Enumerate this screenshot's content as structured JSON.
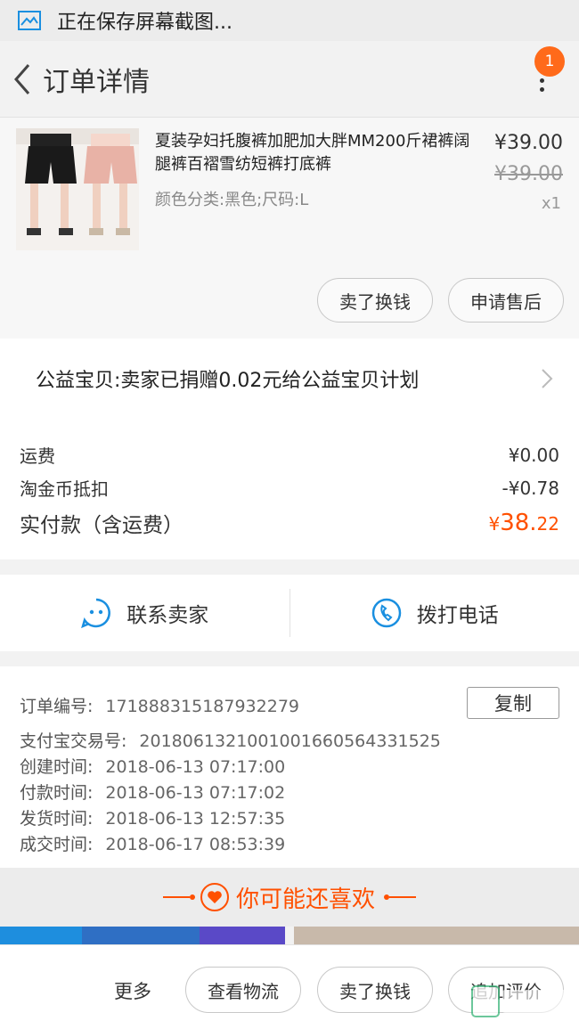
{
  "status": {
    "text": "正在保存屏幕截图..."
  },
  "nav": {
    "title": "订单详情",
    "badge": "1"
  },
  "product": {
    "title": "夏装孕妇托腹裤加肥加大胖MM200斤裙裤阔腿裤百褶雪纺短裤打底裤",
    "sku": "颜色分类:黑色;尺码:L",
    "price": "¥39.00",
    "original_price": "¥39.00",
    "quantity": "x1",
    "btn_sell": "卖了换钱",
    "btn_aftersale": "申请售后"
  },
  "charity": {
    "text": "公益宝贝:卖家已捐赠0.02元给公益宝贝计划"
  },
  "fees": {
    "shipping_label": "运费",
    "shipping_value": "¥0.00",
    "coin_label": "淘金币抵扣",
    "coin_value": "-¥0.78",
    "total_label": "实付款（含运费）",
    "total_currency": "¥",
    "total_int": "38.",
    "total_dec": "22"
  },
  "contact": {
    "seller": "联系卖家",
    "phone": "拨打电话"
  },
  "info": {
    "order_no_label": "订单编号:",
    "order_no": "171888315187932279",
    "copy": "复制",
    "alipay_label": "支付宝交易号:",
    "alipay_no": "2018061321001001660564331525",
    "created_label": "创建时间:",
    "created": "2018-06-13 07:17:00",
    "paid_label": "付款时间:",
    "paid": "2018-06-13 07:17:02",
    "shipped_label": "发货时间:",
    "shipped": "2018-06-13 12:57:35",
    "done_label": "成交时间:",
    "done": "2018-06-17 08:53:39"
  },
  "recommend": {
    "title": "你可能还喜欢"
  },
  "bottom": {
    "more": "更多",
    "logistics": "查看物流",
    "sell": "卖了换钱",
    "review": "追加评价"
  },
  "colors": {
    "accent": "#ff5000",
    "badge": "#ff6a1a",
    "contact_icon": "#1a8fe0"
  }
}
